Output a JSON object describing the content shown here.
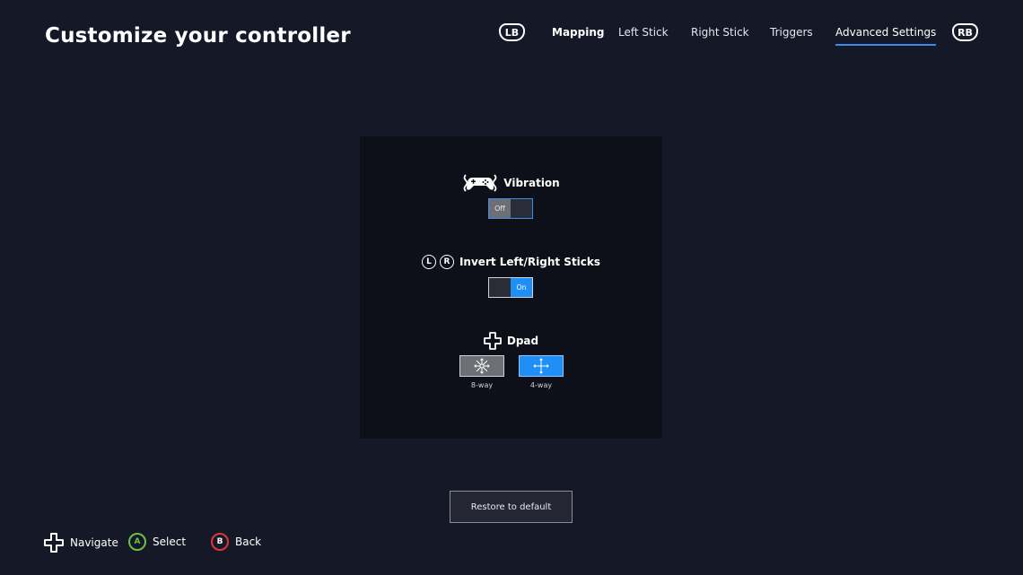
{
  "header": {
    "title": "Customize your controller",
    "left_bumper": "LB",
    "right_bumper": "RB",
    "tabs": [
      {
        "label": "Mapping"
      },
      {
        "label": "Left Stick"
      },
      {
        "label": "Right Stick"
      },
      {
        "label": "Triggers"
      },
      {
        "label": "Advanced Settings",
        "active": true
      }
    ]
  },
  "settings": {
    "vibration": {
      "label": "Vibration",
      "icon": "vibration-controller-icon",
      "value_label": "Off",
      "value": "off"
    },
    "invert_sticks": {
      "label": "Invert Left/Right Sticks",
      "left_glyph": "L",
      "right_glyph": "R",
      "value_label": "On",
      "value": "on"
    },
    "dpad": {
      "label": "Dpad",
      "icon": "dpad-icon",
      "options": [
        {
          "label": "8-way",
          "icon": "eight-way-arrows-icon",
          "selected": false
        },
        {
          "label": "4-way",
          "icon": "four-way-arrows-icon",
          "selected": true
        }
      ]
    }
  },
  "restore_button": "Restore to default",
  "footer": {
    "navigate": {
      "label": "Navigate",
      "icon": "dpad-icon"
    },
    "select": {
      "label": "Select",
      "glyph": "A",
      "color": "#6cc04a"
    },
    "back": {
      "label": "Back",
      "glyph": "B",
      "color": "#e0353b"
    }
  },
  "colors": {
    "background": "#151927",
    "panel": "#0e1019",
    "accent": "#1f8ef5"
  }
}
